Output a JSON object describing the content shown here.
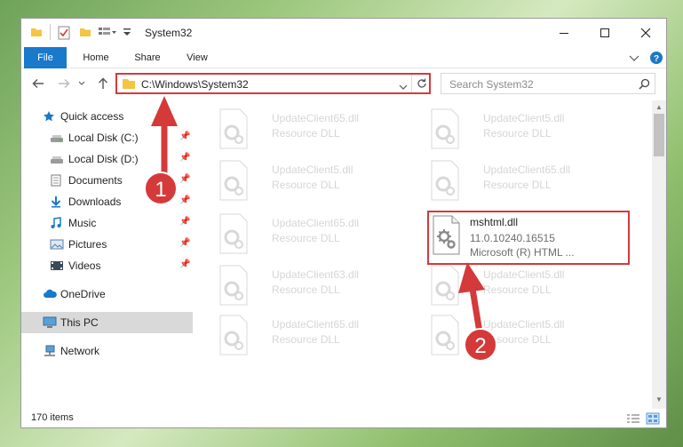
{
  "window": {
    "title": "System32"
  },
  "ribbon": {
    "tabs": [
      "File",
      "Home",
      "Share",
      "View"
    ]
  },
  "address": {
    "path": "C:\\Windows\\System32"
  },
  "search": {
    "placeholder": "Search System32"
  },
  "sidebar": {
    "items": [
      {
        "label": "Quick access",
        "icon": "star-icon"
      },
      {
        "label": "Local Disk (C:)",
        "icon": "drive-icon"
      },
      {
        "label": "Local Disk (D:)",
        "icon": "drive-icon"
      },
      {
        "label": "Documents",
        "icon": "documents-icon"
      },
      {
        "label": "Downloads",
        "icon": "download-icon"
      },
      {
        "label": "Music",
        "icon": "music-icon"
      },
      {
        "label": "Pictures",
        "icon": "pictures-icon"
      },
      {
        "label": "Videos",
        "icon": "videos-icon"
      },
      {
        "label": "OneDrive",
        "icon": "cloud-icon"
      },
      {
        "label": "This PC",
        "icon": "computer-icon"
      },
      {
        "label": "Network",
        "icon": "network-icon"
      }
    ]
  },
  "files": [
    {
      "name": "UpdateClient65.dll",
      "type": "Resource DLL"
    },
    {
      "name": "UpdateClient5.dll",
      "type": "Resource DLL"
    },
    {
      "name": "UpdateClient5.dll",
      "type": "Resource DLL"
    },
    {
      "name": "UpdateClient65.dll",
      "type": "Resource DLL"
    },
    {
      "name": "UpdateClient65.dll",
      "type": "Resource DLL"
    },
    {
      "name": "UpdateClient63.dll",
      "type": "Resource DLL"
    },
    {
      "name": "UpdateClient5.dll",
      "type": "Resource DLL"
    },
    {
      "name": "UpdateClient65.dll",
      "type": "Resource DLL"
    },
    {
      "name": "UpdateClient5.dll",
      "type": "Resource DLL"
    }
  ],
  "highlighted_file": {
    "name": "mshtml.dll",
    "version": "11.0.10240.16515",
    "description": "Microsoft (R) HTML ..."
  },
  "status": {
    "item_count": "170 items"
  },
  "annotations": {
    "step1": "1",
    "step2": "2"
  },
  "colors": {
    "accent": "#1979ca",
    "highlight": "#d43a3a",
    "selection": "#d9d9d9"
  }
}
